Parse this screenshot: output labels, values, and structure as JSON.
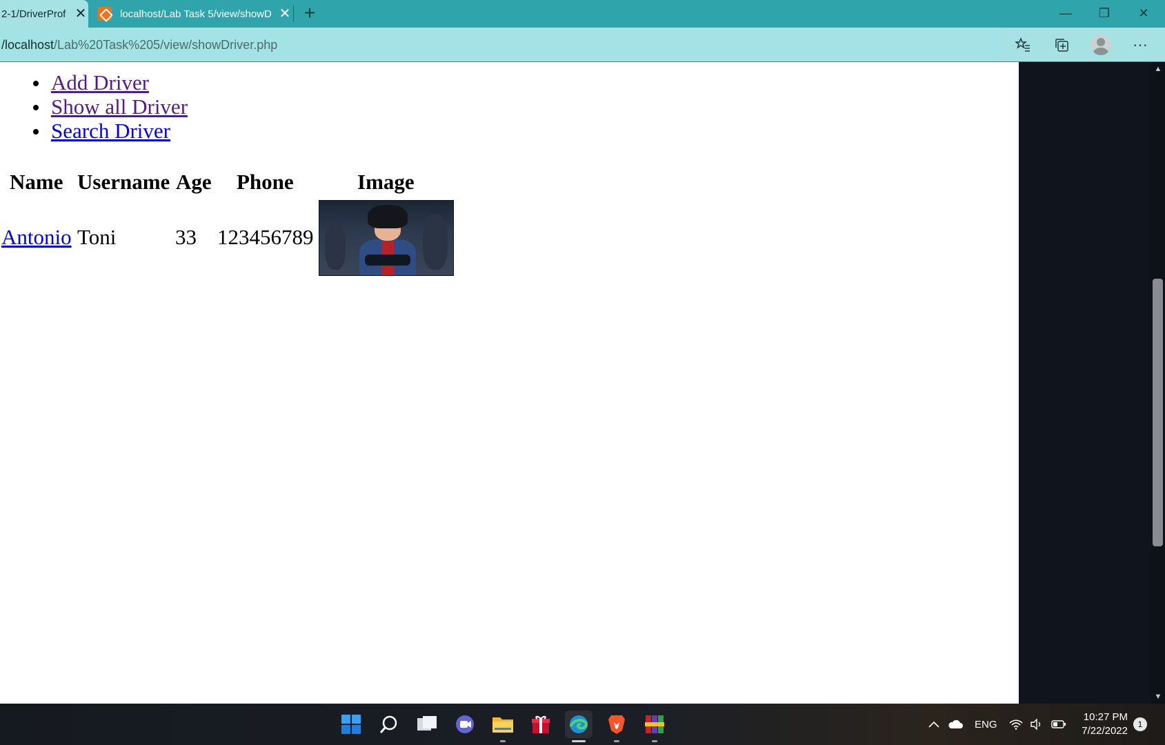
{
  "browser": {
    "tabs": [
      {
        "title": "2-1/DriverProf",
        "close": "✕"
      },
      {
        "title": "localhost/Lab Task 5/view/showD",
        "close": "✕"
      }
    ],
    "new_tab": "+",
    "window_controls": {
      "minimize": "—",
      "restore": "❐",
      "close": "✕"
    },
    "address": {
      "host": "/localhost",
      "path": "/Lab%20Task%205/view/showDriver.php"
    },
    "toolbar_icons": [
      "favorites-icon",
      "collections-icon",
      "profile-icon",
      "more-icon"
    ],
    "more_label": "···"
  },
  "page": {
    "nav": [
      {
        "label": "Add Driver",
        "state": "visited"
      },
      {
        "label": "Show all Driver",
        "state": "visited"
      },
      {
        "label": "Search Driver",
        "state": "unvisited"
      }
    ],
    "table": {
      "headers": {
        "name": "Name",
        "username": "Username",
        "age": "Age",
        "phone": "Phone",
        "image": "Image"
      },
      "rows": [
        {
          "name": "Antonio",
          "username": "Toni",
          "age": "33",
          "phone": "123456789"
        }
      ]
    }
  },
  "taskbar": {
    "apps": [
      "windows-start-icon",
      "search-icon",
      "task-view-icon",
      "teams-chat-icon",
      "file-explorer-icon",
      "gift-icon",
      "edge-browser-icon",
      "brave-browser-icon",
      "winrar-icon"
    ],
    "tray": {
      "language": "ENG",
      "time": "10:27 PM",
      "date": "7/22/2022",
      "notifications": "1"
    }
  },
  "colors": {
    "tabbar": "#2fa5ab",
    "toolbar": "#a6e1e4",
    "link_visited": "#551a8b",
    "link_unvisited": "#0000ee"
  }
}
